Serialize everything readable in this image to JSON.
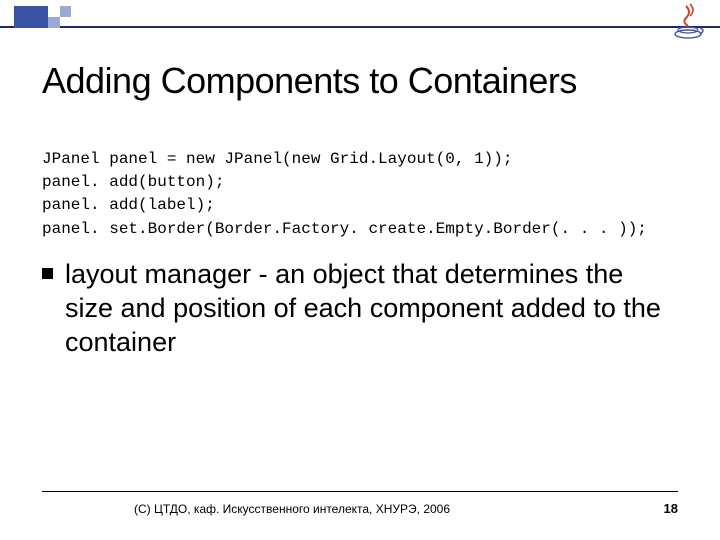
{
  "title": "Adding Components to Containers",
  "code": {
    "l1": "JPanel panel = new JPanel(new Grid.Layout(0, 1));",
    "l2": "panel. add(button);",
    "l3": "panel. add(label);",
    "l4": "panel. set.Border(Border.Factory. create.Empty.Border(. . . ));"
  },
  "bullet": "layout manager - an object that determines the size and position of each component added to the container",
  "copyright": "(C) ЦТДО, каф. Искусственного интелекта, ХНУРЭ, 2006",
  "page": "18",
  "logo_name": "java-logo"
}
